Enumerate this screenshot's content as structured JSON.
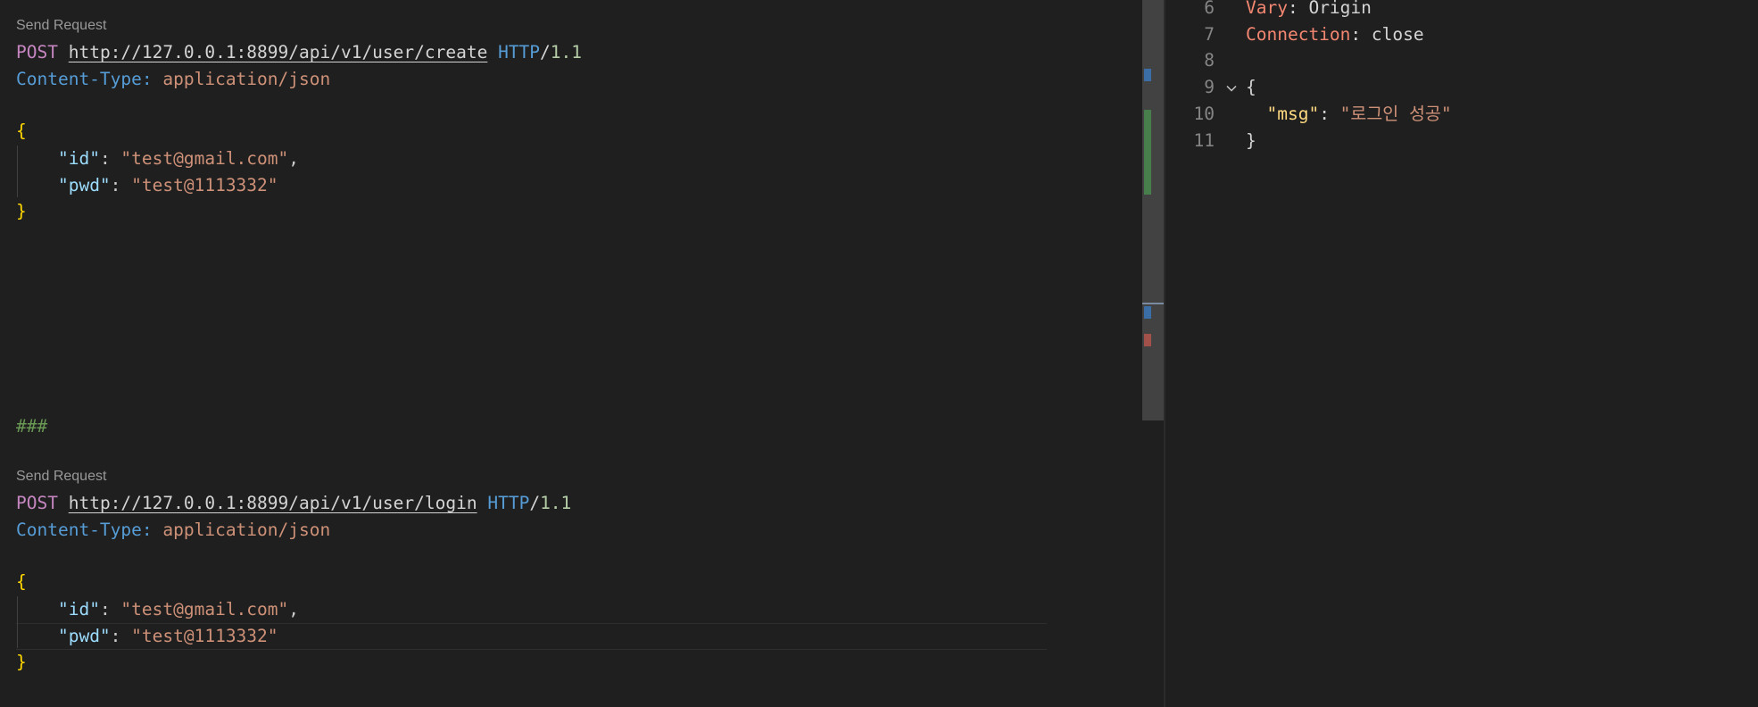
{
  "request_editor": {
    "request1": {
      "codelens": "Send Request",
      "method": "POST",
      "url": "http://127.0.0.1:8899/api/v1/user/create",
      "protocol": "HTTP",
      "slash": "/",
      "version": "1.1",
      "header_name": "Content-Type:",
      "header_value": "application/json",
      "open_brace": "{",
      "id_key": "\"id\"",
      "id_sep": ": ",
      "id_value": "\"test@gmail.com\"",
      "comma": ",",
      "pwd_key": "\"pwd\"",
      "pwd_sep": ": ",
      "pwd_value": "\"test@1113332\"",
      "close_brace": "}"
    },
    "separator": "###",
    "request2": {
      "codelens": "Send Request",
      "method": "POST",
      "url": "http://127.0.0.1:8899/api/v1/user/login",
      "protocol": "HTTP",
      "slash": "/",
      "version": "1.1",
      "header_name": "Content-Type:",
      "header_value": "application/json",
      "open_brace": "{",
      "id_key": "\"id\"",
      "id_sep": ": ",
      "id_value": "\"test@gmail.com\"",
      "comma": ",",
      "pwd_key": "\"pwd\"",
      "pwd_sep": ": ",
      "pwd_value": "\"test@1113332\"",
      "close_brace": "}"
    }
  },
  "response_editor": {
    "line_numbers": [
      "6",
      "7",
      "8",
      "9",
      "10",
      "11"
    ],
    "vary_name": "Vary",
    "vary_sep": ": ",
    "vary_value": "Origin",
    "conn_name": "Connection",
    "conn_sep": ": ",
    "conn_value": "close",
    "open_brace": "{",
    "msg_key": "\"msg\"",
    "msg_sep": ": ",
    "msg_value": "\"로그인 성공\"",
    "close_brace": "}",
    "fold_icon": "chevron-down-icon"
  },
  "colors": {
    "background": "#1f1f1f",
    "method": "#c586c0",
    "protocol": "#569cd6",
    "string": "#ce9178",
    "key": "#9cdcfe",
    "brace": "#ffd700",
    "comment": "#6a9955",
    "response_header": "#f48771"
  }
}
